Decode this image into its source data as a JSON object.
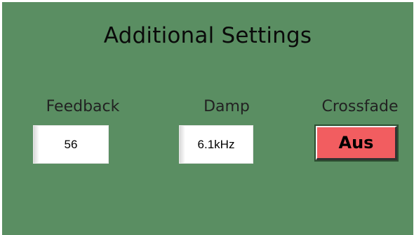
{
  "title": "Additional Settings",
  "controls": {
    "feedback": {
      "label": "Feedback",
      "value": "56"
    },
    "damp": {
      "label": "Damp",
      "value": "6.1kHz"
    },
    "crossfade": {
      "label": "Crossfade",
      "state": "Aus",
      "color": "#f25d60"
    }
  },
  "colors": {
    "panel_background": "#5a8e62"
  }
}
